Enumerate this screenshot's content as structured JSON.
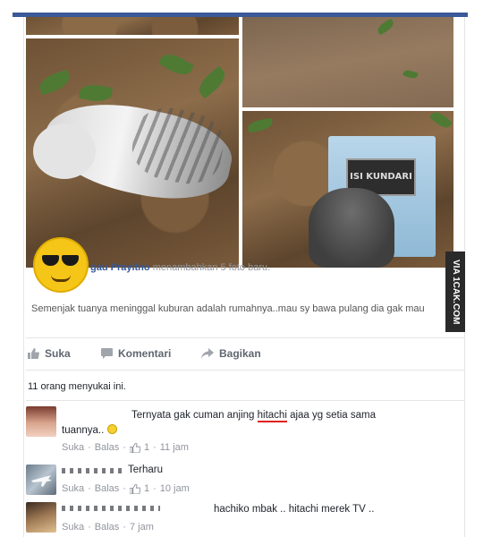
{
  "post": {
    "author_name": "gau Prayitno",
    "action_text": "menambahkan 5 foto baru.",
    "text": "Semenjak tuanya meninggal kuburan adalah rumahnya..mau sy bawa pulang dia gak mau",
    "tombstone_plaque": "ISI KUNDARI",
    "watermark": "VIA 1CAK.COM"
  },
  "actions": {
    "like_label": "Suka",
    "comment_label": "Komentari",
    "share_label": "Bagikan"
  },
  "likes_text": "11 orang menyukai ini.",
  "comments": [
    {
      "text_before": "Ternyata gak cuman anjing ",
      "text_highlight": "hitachi",
      "text_after": " ajaa yg setia sama",
      "text_line2": "tuannya..",
      "like_label": "Suka",
      "reply_label": "Balas",
      "like_count": "1",
      "time": "11 jam"
    },
    {
      "text": "Terharu",
      "like_label": "Suka",
      "reply_label": "Balas",
      "like_count": "1",
      "time": "10 jam"
    },
    {
      "text": "hachiko mbak .. hitachi merek TV ..",
      "like_label": "Suka",
      "reply_label": "Balas",
      "time": "7 jam"
    }
  ],
  "meta_separator": "·",
  "colors": {
    "brand": "#3b5998",
    "link": "#365899",
    "highlight_underline": "#e02020",
    "emoji_yellow": "#f5c518"
  }
}
